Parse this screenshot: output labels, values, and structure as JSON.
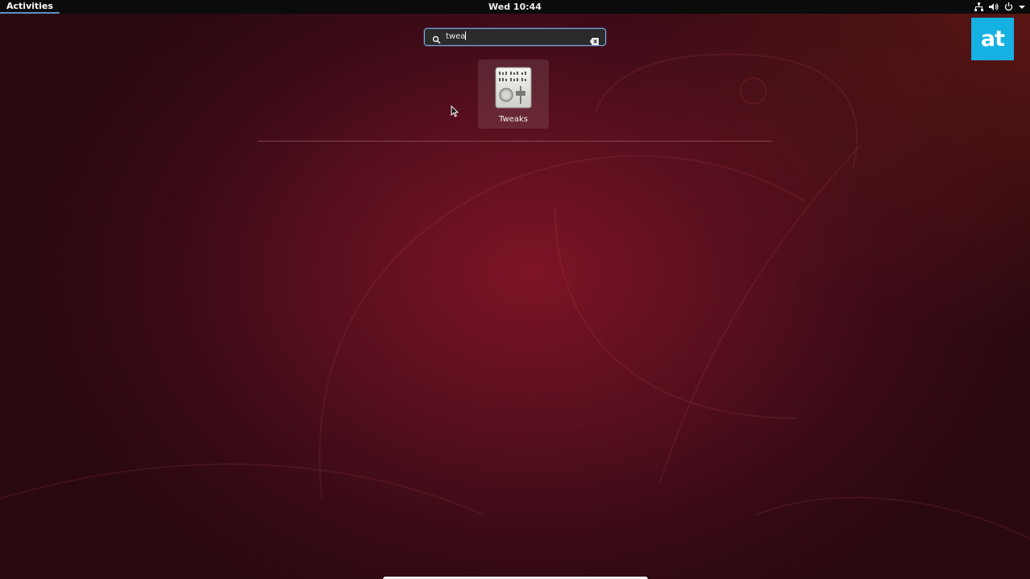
{
  "topbar": {
    "activities_label": "Activities",
    "clock": "Wed 10:44",
    "tray_icons": [
      "network-icon",
      "volume-icon",
      "power-icon",
      "chevron-down-icon"
    ]
  },
  "search": {
    "value": "twea",
    "icon": "search-icon",
    "clear_icon": "clear-icon"
  },
  "results": [
    {
      "label": "Tweaks",
      "icon": "tweaks-app-icon"
    }
  ],
  "brand": {
    "logo_text": "at",
    "color": "#16b1e3"
  },
  "colors": {
    "accent": "#7fa5d9",
    "wallpaper": "#5a0f1e"
  }
}
